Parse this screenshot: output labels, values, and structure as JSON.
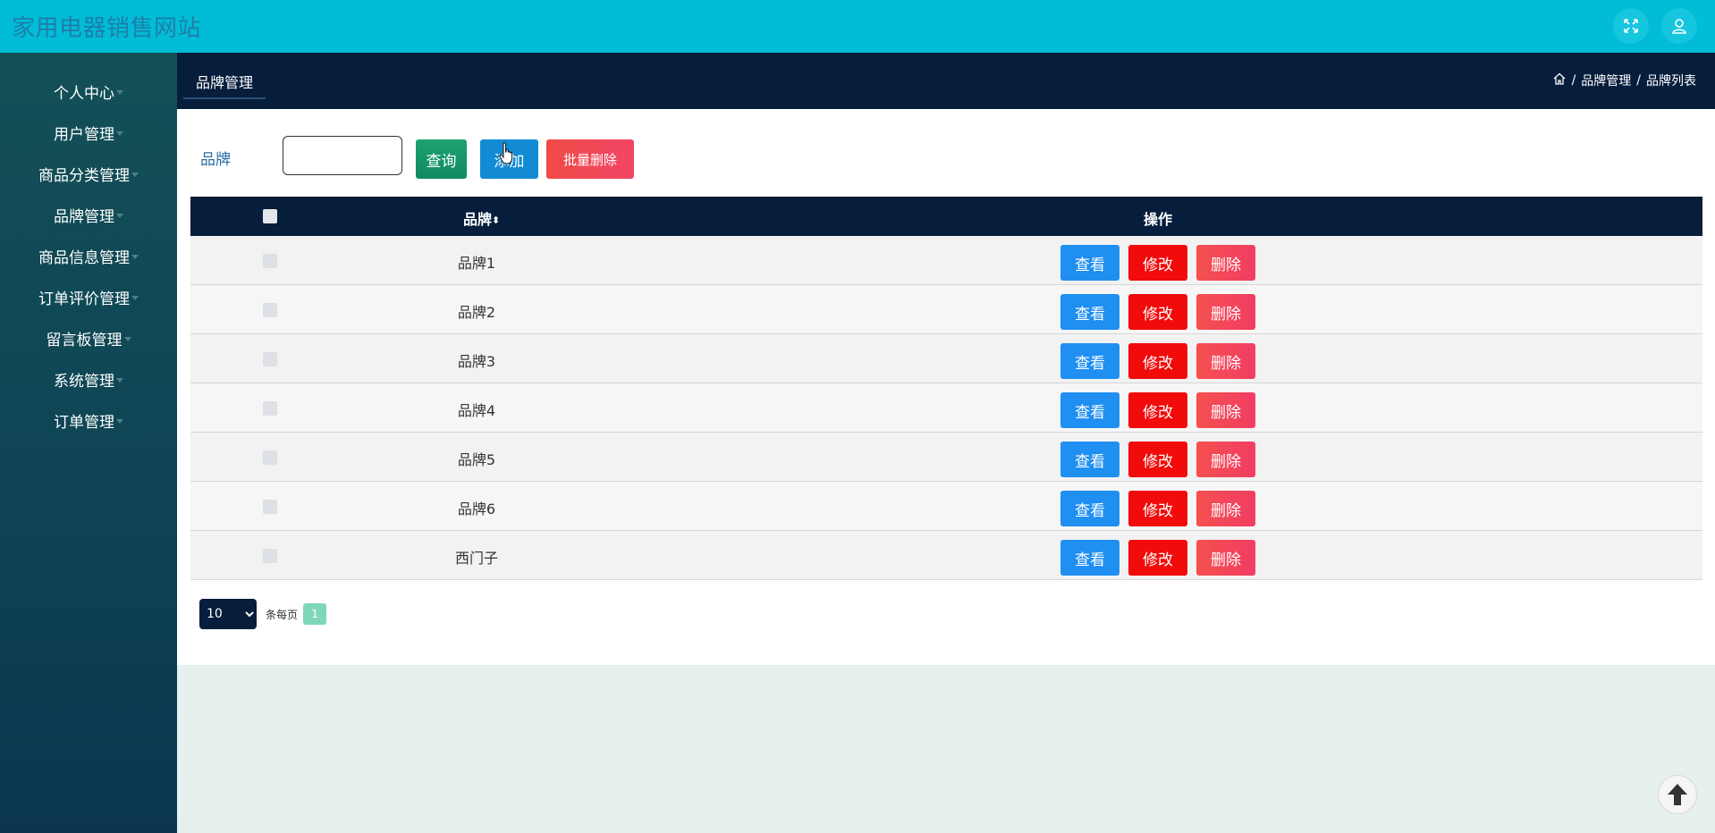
{
  "app": {
    "title": "家用电器销售网站"
  },
  "topbar": {
    "fullscreen_icon": "fullscreen-icon",
    "user_icon": "user-icon"
  },
  "sidebar": {
    "items": [
      {
        "label": "个人中心"
      },
      {
        "label": "用户管理"
      },
      {
        "label": "商品分类管理"
      },
      {
        "label": "品牌管理"
      },
      {
        "label": "商品信息管理"
      },
      {
        "label": "订单评价管理"
      },
      {
        "label": "留言板管理"
      },
      {
        "label": "系统管理"
      },
      {
        "label": "订单管理"
      }
    ]
  },
  "subheader": {
    "tab": "品牌管理",
    "breadcrumb": {
      "home_icon": "home-icon",
      "sep": "/",
      "level1": "品牌管理",
      "level2": "品牌列表"
    }
  },
  "search": {
    "label": "品牌",
    "value": "",
    "query_label": "查询",
    "add_label": "添加",
    "batch_delete_label": "批量删除"
  },
  "table": {
    "headers": {
      "brand": "品牌",
      "sort_glyph": "⬍",
      "ops": "操作"
    },
    "rows": [
      {
        "brand": "品牌1"
      },
      {
        "brand": "品牌2"
      },
      {
        "brand": "品牌3"
      },
      {
        "brand": "品牌4"
      },
      {
        "brand": "品牌5"
      },
      {
        "brand": "品牌6"
      },
      {
        "brand": "西门子"
      }
    ],
    "actions": {
      "view": "查看",
      "edit": "修改",
      "delete": "删除"
    }
  },
  "pager": {
    "page_size": "10",
    "per_page_label": "条每页",
    "current_page": "1"
  },
  "colors": {
    "topbar": "#00bcd7",
    "nav_dark": "#061d3b",
    "view": "#1f8ff2",
    "edit": "#f20b0b",
    "delete": "#f23d63",
    "query": "#0e8a5f",
    "add": "#128bd4"
  }
}
